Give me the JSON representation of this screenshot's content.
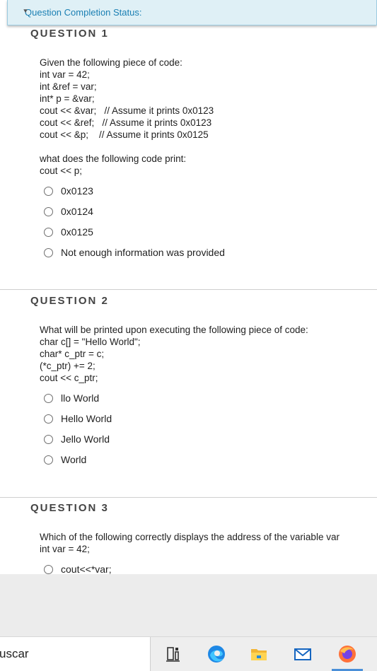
{
  "status": {
    "label": "Question Completion Status:"
  },
  "questions": [
    {
      "title": "QUESTION 1",
      "lines": [
        "Given the following piece of code:",
        "int var = 42;",
        "int &ref = var;",
        "int* p = &var;",
        "cout << &var;   // Assume it prints 0x0123",
        "cout << &ref;   // Assume it prints 0x0123",
        "cout << &p;    // Assume it prints 0x0125",
        "",
        "what does the following code print:",
        "cout << p;"
      ],
      "options": [
        "0x0123",
        "0x0124",
        "0x0125",
        "Not enough information was provided"
      ]
    },
    {
      "title": "QUESTION 2",
      "lines": [
        "What will be printed upon executing the following piece of code:",
        "char c[] = \"Hello World\";",
        "char* c_ptr = c;",
        "(*c_ptr) += 2;",
        "cout << c_ptr;"
      ],
      "options": [
        "llo World",
        "Hello World",
        "Jello World",
        "World"
      ]
    },
    {
      "title": "QUESTION 3",
      "lines": [
        "Which of the following correctly displays the address of the variable var",
        "int var = 42;"
      ],
      "options": [
        "cout<<*var;"
      ]
    }
  ],
  "taskbar": {
    "search_text": "uscar",
    "icons": [
      "task-view-icon",
      "edge-icon",
      "file-explorer-icon",
      "mail-icon",
      "firefox-icon"
    ]
  }
}
